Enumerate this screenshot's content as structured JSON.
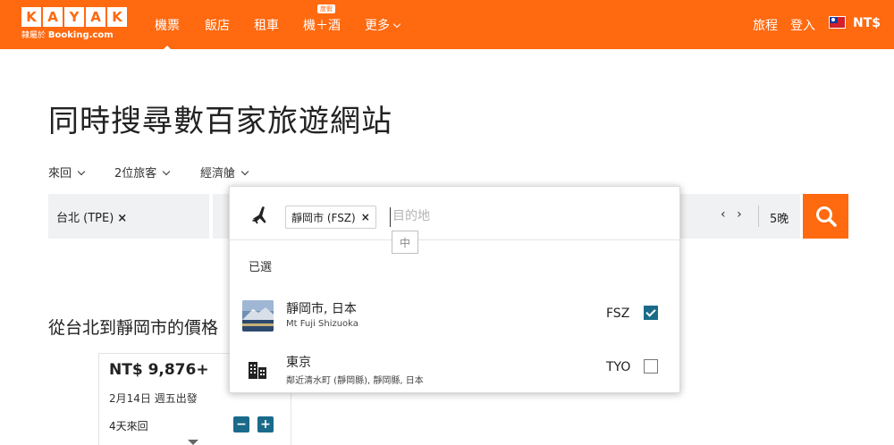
{
  "header": {
    "logo_letters": [
      "K",
      "A",
      "Y",
      "A",
      "K"
    ],
    "logo_tagline": "隸屬於",
    "logo_tagline_brand": "Booking.com",
    "nav": {
      "flights": "機票",
      "hotels": "飯店",
      "cars": "租車",
      "packages": "機＋酒",
      "packages_badge": "度假",
      "more": "更多"
    },
    "trips": "旅程",
    "login": "登入",
    "currency": "NT$"
  },
  "hero": {
    "title": "同時搜尋數百家旅遊網站"
  },
  "search_options": {
    "trip_type": "來回",
    "travelers": "2位旅客",
    "cabin": "經濟艙"
  },
  "search_bar": {
    "origin": "台北 (TPE)",
    "origin_remove": "×",
    "date_prev": "‹",
    "date_next": "›",
    "nights": "5晚"
  },
  "destination_popover": {
    "selected_chip": "靜岡市 (FSZ)",
    "chip_remove": "×",
    "input_placeholder": "目的地",
    "ime_indicator": "中",
    "selected_heading": "已選",
    "results": [
      {
        "name": "靜岡市, 日本",
        "subtitle": "Mt Fuji Shizuoka",
        "code": "FSZ",
        "checked": true,
        "icon": "photo-thumbnail"
      },
      {
        "name": "東京",
        "subtitle": "鄰近清水町 (靜岡縣), 靜岡縣, 日本",
        "code": "TYO",
        "checked": false,
        "icon": "building-icon"
      }
    ]
  },
  "price_section": {
    "title": "從台北到靜岡市的價格",
    "card": {
      "price": "NT$ 9,876+",
      "date": "2月14日 週五出發",
      "trip_length": "4天來回",
      "minus": "−",
      "plus": "+"
    }
  },
  "colors": {
    "brand_orange": "#ff690f",
    "checkbox_teal": "#1a6b8a"
  }
}
